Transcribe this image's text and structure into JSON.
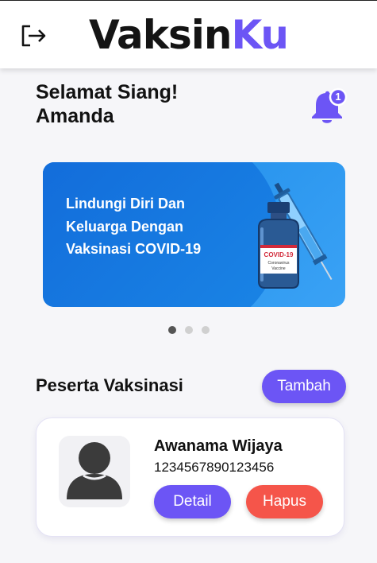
{
  "header": {
    "brand_part1": "Vaksin",
    "brand_part2": "Ku",
    "icon_logout": "logout-icon",
    "brand_color": "#6c55f5"
  },
  "greeting": {
    "line1": "Selamat Siang!",
    "line2": "Amanda"
  },
  "notifications": {
    "icon": "bell-icon",
    "count": "1"
  },
  "banner": {
    "line1": "Lindungi Diri Dan",
    "line2": "Keluarga Dengan",
    "line3": "Vaksinasi COVID-19",
    "vial_label1": "COVID-19",
    "vial_label2": "Coronavirus",
    "vial_label3": "Vaccine",
    "slides_total": 3,
    "active_slide": 1
  },
  "participants": {
    "title": "Peserta Vaksinasi",
    "add_label": "Tambah",
    "items": [
      {
        "name": "Awanama Wijaya",
        "nik": "1234567890123456",
        "detail_label": "Detail",
        "delete_label": "Hapus"
      }
    ]
  },
  "colors": {
    "primary": "#6c55f5",
    "danger": "#f5554a",
    "banner": "#1c8ae8"
  }
}
